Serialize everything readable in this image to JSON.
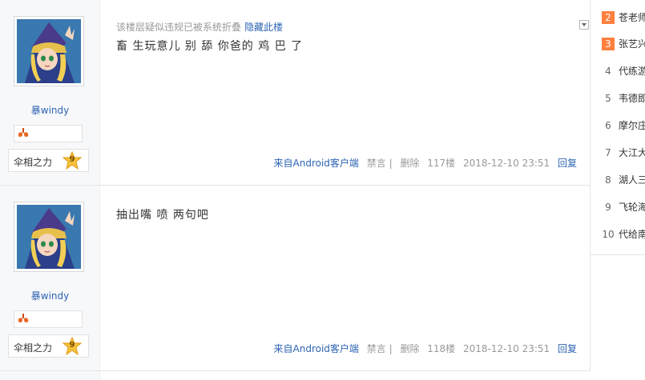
{
  "posts": [
    {
      "author": "暴windy",
      "level_title": "伞相之力",
      "level": "9",
      "fold_notice": "该楼层疑似违规已被系统折叠",
      "fold_link": "隐藏此楼",
      "content": "畜 生玩意儿 别 舔 你爸的 鸡 巴 了",
      "client": "来自Android客户端",
      "ban": "禁言 |",
      "delete": "删除",
      "floor": "117楼",
      "time": "2018-12-10 23:51",
      "reply": "回复"
    },
    {
      "author": "暴windy",
      "level_title": "伞相之力",
      "level": "9",
      "content": "抽出嘴 喷 两句吧",
      "client": "来自Android客户端",
      "ban": "禁言 |",
      "delete": "删除",
      "floor": "118楼",
      "time": "2018-12-10 23:51",
      "reply": "回复"
    }
  ],
  "ranking": [
    {
      "num": "2",
      "title": "苍老师"
    },
    {
      "num": "3",
      "title": "张艺兴"
    },
    {
      "num": "4",
      "title": "代练游"
    },
    {
      "num": "5",
      "title": "韦德即"
    },
    {
      "num": "6",
      "title": "摩尔庄"
    },
    {
      "num": "7",
      "title": "大江大"
    },
    {
      "num": "8",
      "title": "湖人三"
    },
    {
      "num": "9",
      "title": "飞轮海"
    },
    {
      "num": "10",
      "title": "代给南"
    }
  ],
  "icons": {
    "avatar": "avatar-image",
    "badge": "lungs-badge-icon",
    "level": "star-level-icon",
    "menu": "chevron-down-icon"
  },
  "colors": {
    "link": "#2d64b3",
    "hot_rank": "#ff7f3e",
    "meta": "#999999"
  }
}
